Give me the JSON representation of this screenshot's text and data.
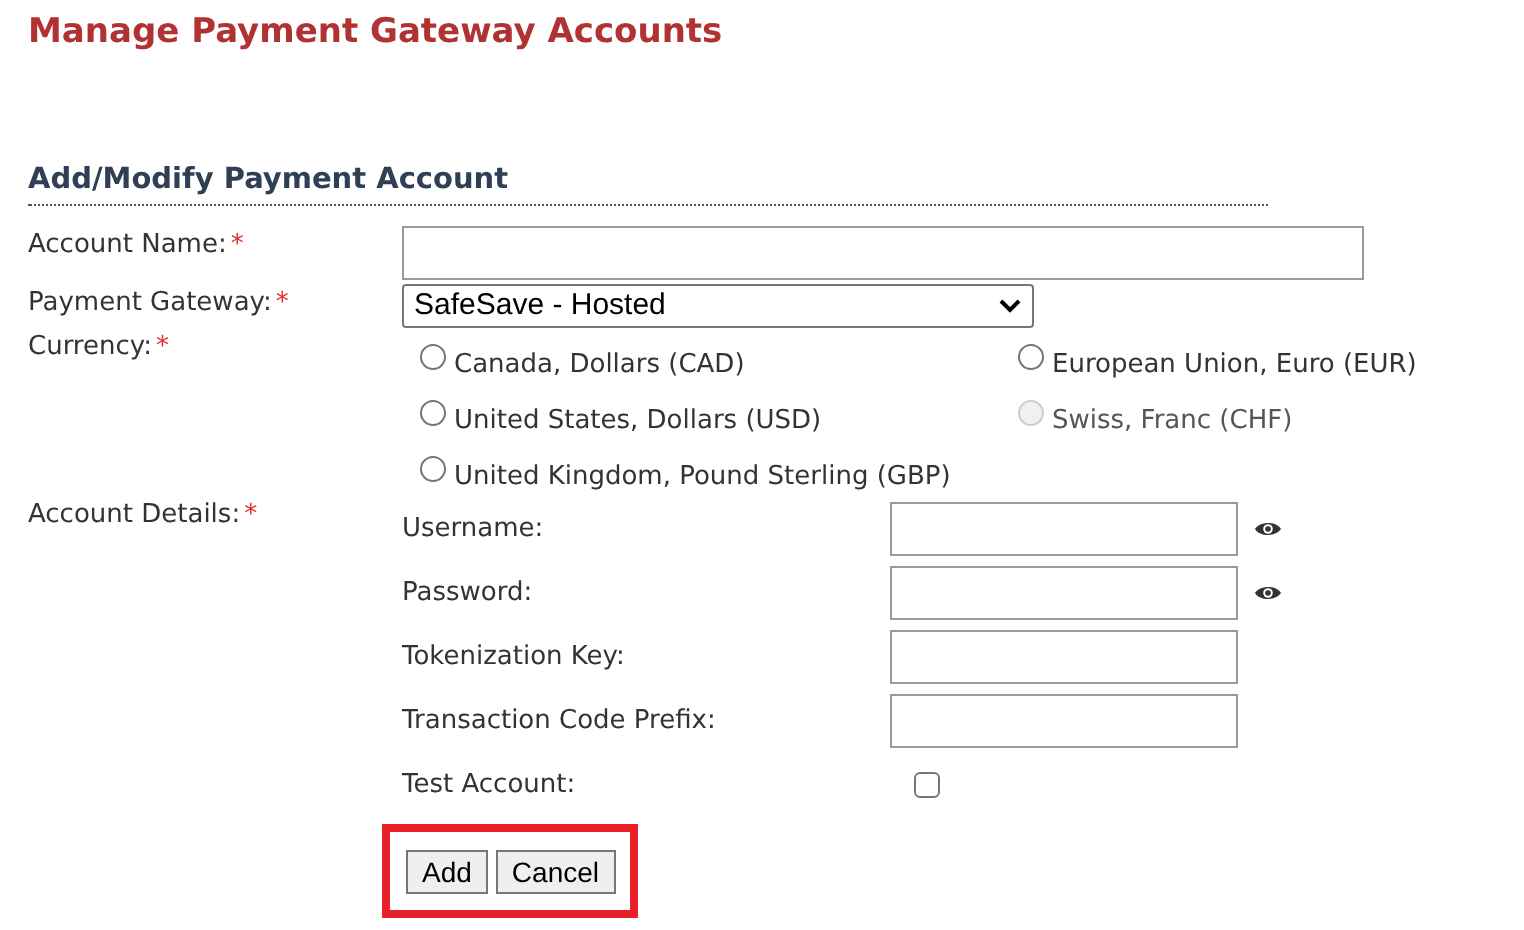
{
  "page_title": "Manage Payment Gateway Accounts",
  "section_title": "Add/Modify Payment Account",
  "account_name": {
    "label": "Account Name:",
    "required_mark": "*"
  },
  "payment_gateway": {
    "label": "Payment Gateway:",
    "required_mark": "*",
    "value": "SafeSave - Hosted"
  },
  "currency": {
    "label": "Currency:",
    "required_mark": "*",
    "options": [
      {
        "label": "Canada, Dollars (CAD)",
        "selected": false,
        "disabled": false
      },
      {
        "label": "European Union, Euro (EUR)",
        "selected": false,
        "disabled": false
      },
      {
        "label": "United States, Dollars (USD)",
        "selected": false,
        "disabled": false
      },
      {
        "label": "Swiss, Franc (CHF)",
        "selected": false,
        "disabled": true
      },
      {
        "label": "United Kingdom, Pound Sterling (GBP)",
        "selected": false,
        "disabled": false
      }
    ]
  },
  "account_details": {
    "label": "Account Details:",
    "required_mark": "*",
    "fields": [
      {
        "kind": "secret",
        "label": "Username:"
      },
      {
        "kind": "secret",
        "label": "Password:"
      },
      {
        "kind": "text",
        "label": "Tokenization Key:"
      },
      {
        "kind": "text",
        "label": "Transaction Code Prefix:"
      },
      {
        "kind": "checkbox",
        "label": "Test Account:",
        "checked": false
      }
    ]
  },
  "buttons": [
    "Add",
    "Cancel"
  ],
  "buttons_highlighted": true
}
